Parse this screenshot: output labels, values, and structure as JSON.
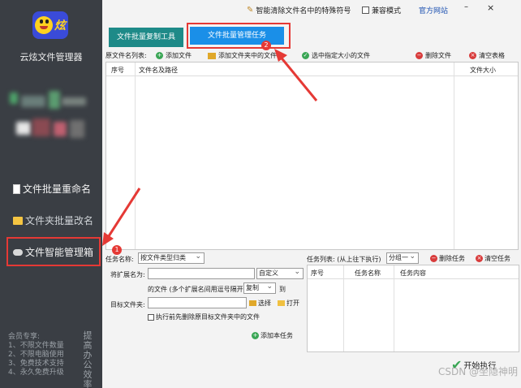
{
  "sidebar": {
    "app_name": "云炫文件管理器",
    "nav": [
      {
        "label": "文件批量重命名"
      },
      {
        "label": "文件夹批量改名"
      },
      {
        "label": "文件智能管理箱"
      }
    ],
    "promo_lines": [
      "会员专享:",
      "1、不限文件数量",
      "2、不限电脑使用",
      "3、免费技术支持",
      "4、永久免费升级"
    ],
    "promo_vertical": "提高办公效率"
  },
  "titlebar": {
    "special_link": "智能清除文件名中的特殊符号",
    "compat_mode": "兼容模式",
    "website": "官方网站",
    "minimize": "–",
    "close": "×"
  },
  "tabs": [
    {
      "label": "文件批量复制工具",
      "active": false
    },
    {
      "label": "文件批量管理任务",
      "active": true
    }
  ],
  "toolbar": {
    "list_label": "原文件名列表:",
    "add_file": "添加文件",
    "add_folder": "添加文件夹中的文件",
    "select_size": "选中指定大小的文件",
    "delete_file": "删除文件",
    "clear_table": "清空表格"
  },
  "file_table": {
    "columns": [
      "序号",
      "文件名及路径",
      "文件大小"
    ]
  },
  "task_form": {
    "task_name_label": "任务名称:",
    "task_name_value": "按文件类型归类",
    "ext_label": "将扩展名为:",
    "ext_value": "",
    "custom_select": "自定义",
    "files_hint": "的文件 (多个扩展名间用逗号隔开)",
    "op_select": "复制",
    "to_label": "到",
    "target_label": "目标文件夹:",
    "target_value": "",
    "choose_btn": "选择",
    "open_btn": "打开",
    "delete_before_label": "执行前先删除原目标文件夹中的文件",
    "add_task_btn": "添加本任务"
  },
  "task_list": {
    "label": "任务列表: (从上往下执行)",
    "group_select": "分组一",
    "delete_task": "删除任务",
    "clear_task": "清空任务",
    "columns": [
      "序号",
      "任务名称",
      "任务内容"
    ]
  },
  "start_btn": "开始执行",
  "annotations": [
    "1",
    "2"
  ],
  "watermark": "CSDN @坐隐神明",
  "colors": {
    "sidebar_bg": "#3a3e44",
    "tab_inactive": "#1e8a88",
    "tab_active": "#1a8fe8",
    "highlight": "#e53935",
    "add_green": "#3aa655",
    "delete_red": "#d83b3b"
  }
}
